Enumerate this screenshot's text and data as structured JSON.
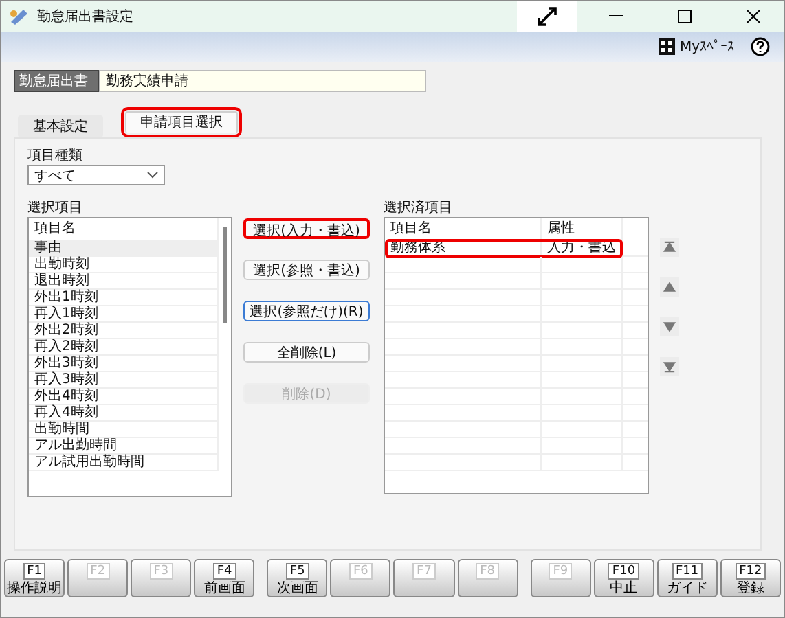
{
  "window": {
    "title": "勤怠届出書設定"
  },
  "toolbar": {
    "myspace": "Myｽﾍﾟｰｽ"
  },
  "header": {
    "label": "勤怠届出書",
    "value": "勤務実績申請"
  },
  "tabs": [
    {
      "label": "基本設定",
      "selected": false,
      "highlighted": false
    },
    {
      "label": "申請項目選択",
      "selected": true,
      "highlighted": true
    }
  ],
  "item_type": {
    "label": "項目種類",
    "value": "すべて"
  },
  "available": {
    "title": "選択項目",
    "column": "項目名",
    "rows": [
      {
        "name": "事由",
        "selected": true
      },
      {
        "name": "出勤時刻",
        "selected": false
      },
      {
        "name": "退出時刻",
        "selected": false
      },
      {
        "name": "外出1時刻",
        "selected": false
      },
      {
        "name": "再入1時刻",
        "selected": false
      },
      {
        "name": "外出2時刻",
        "selected": false
      },
      {
        "name": "再入2時刻",
        "selected": false
      },
      {
        "name": "外出3時刻",
        "selected": false
      },
      {
        "name": "再入3時刻",
        "selected": false
      },
      {
        "name": "外出4時刻",
        "selected": false
      },
      {
        "name": "再入4時刻",
        "selected": false
      },
      {
        "name": "出勤時間",
        "selected": false
      },
      {
        "name": "アル出勤時間",
        "selected": false
      },
      {
        "name": "アル試用出勤時間",
        "selected": false
      }
    ]
  },
  "actions": [
    {
      "label": "選択(入力・書込)",
      "disabled": false,
      "focused": false,
      "highlighted": true
    },
    {
      "label": "選択(参照・書込)",
      "disabled": false,
      "focused": false,
      "highlighted": false
    },
    {
      "label": "選択(参照だけ)(R)",
      "disabled": false,
      "focused": true,
      "highlighted": false
    },
    {
      "label": "全削除(L)",
      "disabled": false,
      "focused": false,
      "highlighted": false
    },
    {
      "label": "削除(D)",
      "disabled": true,
      "focused": false,
      "highlighted": false
    }
  ],
  "chosen": {
    "title": "選択済項目",
    "columns": [
      "項目名",
      "属性"
    ],
    "rows": [
      {
        "name": "勤務体系",
        "attribute": "入力・書込",
        "highlighted": true
      }
    ]
  },
  "order_buttons": [
    {
      "kind": "top"
    },
    {
      "kind": "up"
    },
    {
      "kind": "down"
    },
    {
      "kind": "bottom"
    }
  ],
  "function_keys": [
    {
      "key": "F1",
      "label": "操作説明",
      "disabled": false
    },
    {
      "key": "F2",
      "disabled": true
    },
    {
      "key": "F3",
      "disabled": true
    },
    {
      "key": "F4",
      "label": "前画面",
      "disabled": false
    },
    {
      "key": "F5",
      "label": "次画面",
      "disabled": false
    },
    {
      "key": "F6",
      "disabled": true
    },
    {
      "key": "F7",
      "disabled": true
    },
    {
      "key": "F8",
      "disabled": true
    },
    {
      "key": "F9",
      "disabled": true
    },
    {
      "key": "F10",
      "label": "中止",
      "disabled": false
    },
    {
      "key": "F11",
      "label": "ガイド",
      "disabled": false
    },
    {
      "key": "F12",
      "label": "登録",
      "disabled": false
    }
  ]
}
